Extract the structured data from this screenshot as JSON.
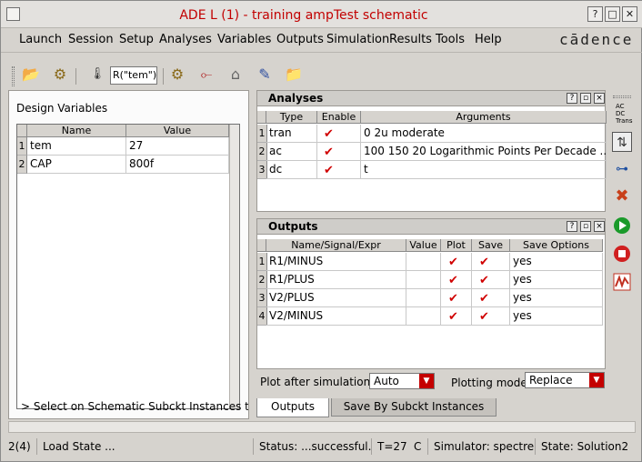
{
  "title": "ADE L (1) - training ampTest schematic",
  "window_buttons": [
    "?",
    "□",
    "✕"
  ],
  "brand": "cādence",
  "menu": [
    "Launch",
    "Session",
    "Setup",
    "Analyses",
    "Variables",
    "Outputs",
    "Simulation",
    "Results",
    "Tools",
    "Help"
  ],
  "toolbar": {
    "temp_value": "R(\"tem\")"
  },
  "design_vars": {
    "title": "Design Variables",
    "headers": [
      "Name",
      "Value"
    ],
    "rows": [
      {
        "num": "1",
        "name": "tem",
        "value": "27"
      },
      {
        "num": "2",
        "name": "CAP",
        "value": "800f"
      }
    ]
  },
  "hint": "> Select on Schematic Subckt Instances to t",
  "analyses": {
    "title": "Analyses",
    "headers": [
      "Type",
      "Enable",
      "Arguments"
    ],
    "rows": [
      {
        "num": "1",
        "type": "tran",
        "enabled": true,
        "args": "0 2u moderate"
      },
      {
        "num": "2",
        "type": "ac",
        "enabled": true,
        "args": "100 150 20 Logarithmic Points Per Decade ..."
      },
      {
        "num": "3",
        "type": "dc",
        "enabled": true,
        "args": "t"
      }
    ]
  },
  "outputs": {
    "title": "Outputs",
    "headers": [
      "Name/Signal/Expr",
      "Value",
      "Plot",
      "Save",
      "Save Options"
    ],
    "rows": [
      {
        "num": "1",
        "name": "R1/MINUS",
        "value": "",
        "plot": true,
        "save": true,
        "opt": "yes"
      },
      {
        "num": "2",
        "name": "R1/PLUS",
        "value": "",
        "plot": true,
        "save": true,
        "opt": "yes"
      },
      {
        "num": "3",
        "name": "V2/PLUS",
        "value": "",
        "plot": true,
        "save": true,
        "opt": "yes"
      },
      {
        "num": "4",
        "name": "V2/MINUS",
        "value": "",
        "plot": true,
        "save": true,
        "opt": "yes"
      }
    ]
  },
  "plot_after": {
    "label": "Plot after simulation:",
    "value": "Auto"
  },
  "plot_mode": {
    "label": "Plotting mode:",
    "value": "Replace"
  },
  "tabs": [
    "Outputs",
    "Save By Subckt Instances"
  ],
  "right_toolbar": {
    "ac_labels": [
      "AC",
      "DC",
      "Trans"
    ]
  },
  "status": {
    "count": "2(4)",
    "load": "Load State ...",
    "status": "Status: ...successful.",
    "temp": "T=27",
    "unit": "C",
    "simulator": "Simulator: spectre",
    "state": "State: Solution2"
  },
  "colors": {
    "title": "#c20000",
    "check": "#d00000",
    "accent_red": "#c40000",
    "run_green": "#1a9a2a"
  }
}
